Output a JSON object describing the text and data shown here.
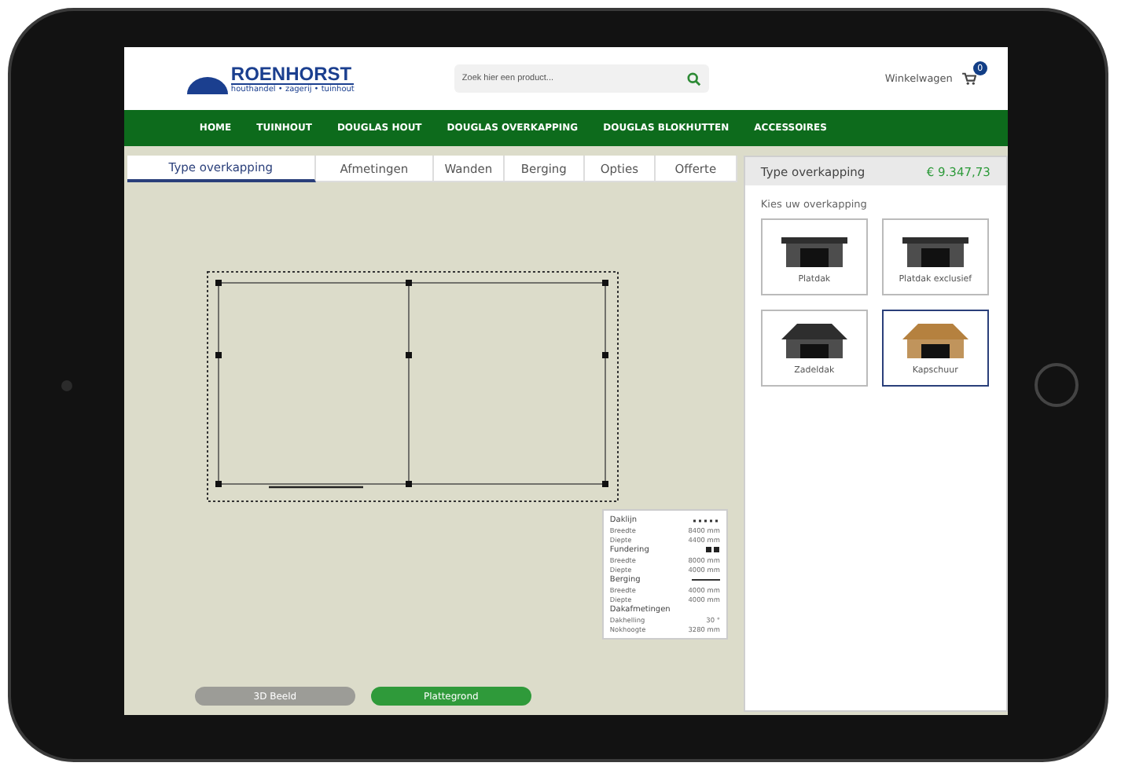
{
  "header": {
    "logo_name": "ROENHORST",
    "logo_tagline": "houthandel • zagerij • tuinhout",
    "search": {
      "placeholder": "Zoek hier een product..."
    },
    "cart_label": "Winkelwagen",
    "cart_count": "0"
  },
  "nav": [
    "HOME",
    "TUINHOUT",
    "DOUGLAS HOUT",
    "DOUGLAS OVERKAPPING",
    "DOUGLAS BLOKHUTTEN",
    "ACCESSOIRES"
  ],
  "tabs": [
    {
      "label": "Type overkapping",
      "selected": true
    },
    {
      "label": "Afmetingen",
      "selected": false
    },
    {
      "label": "Wanden",
      "selected": false
    },
    {
      "label": "Berging",
      "selected": false
    },
    {
      "label": "Opties",
      "selected": false
    },
    {
      "label": "Offerte",
      "selected": false
    }
  ],
  "legend": [
    {
      "title": "Daklijn",
      "kind": "dotted",
      "rows": [
        {
          "label": "Breedte",
          "value": "8400 mm"
        },
        {
          "label": "Diepte",
          "value": "4400 mm"
        }
      ]
    },
    {
      "title": "Fundering",
      "kind": "dots",
      "rows": [
        {
          "label": "Breedte",
          "value": "8000 mm"
        },
        {
          "label": "Diepte",
          "value": "4000 mm"
        }
      ]
    },
    {
      "title": "Berging",
      "kind": "solid",
      "rows": [
        {
          "label": "Breedte",
          "value": "4000 mm"
        },
        {
          "label": "Diepte",
          "value": "4000 mm"
        }
      ]
    },
    {
      "title": "Dakafmetingen",
      "kind": "plain",
      "rows": [
        {
          "label": "Dakhelling",
          "value": "30 °"
        },
        {
          "label": "Nokhoogte",
          "value": "3280 mm"
        }
      ]
    }
  ],
  "view_buttons": [
    {
      "label": "3D Beeld",
      "selected": false
    },
    {
      "label": "Plattegrond",
      "selected": true
    }
  ],
  "panel": {
    "title": "Type overkapping",
    "price": "€ 9.347,73",
    "prompt": "Kies uw overkapping",
    "options": [
      {
        "label": "Platdak",
        "kind": "flat",
        "color": "#2e2e2e",
        "selected": false
      },
      {
        "label": "Platdak exclusief",
        "kind": "flat",
        "color": "#2e2e2e",
        "selected": false
      },
      {
        "label": "Zadeldak",
        "kind": "gable",
        "color": "#2e2e2e",
        "selected": false
      },
      {
        "label": "Kapschuur",
        "kind": "gable",
        "color": "#b5813f",
        "selected": true
      }
    ]
  }
}
